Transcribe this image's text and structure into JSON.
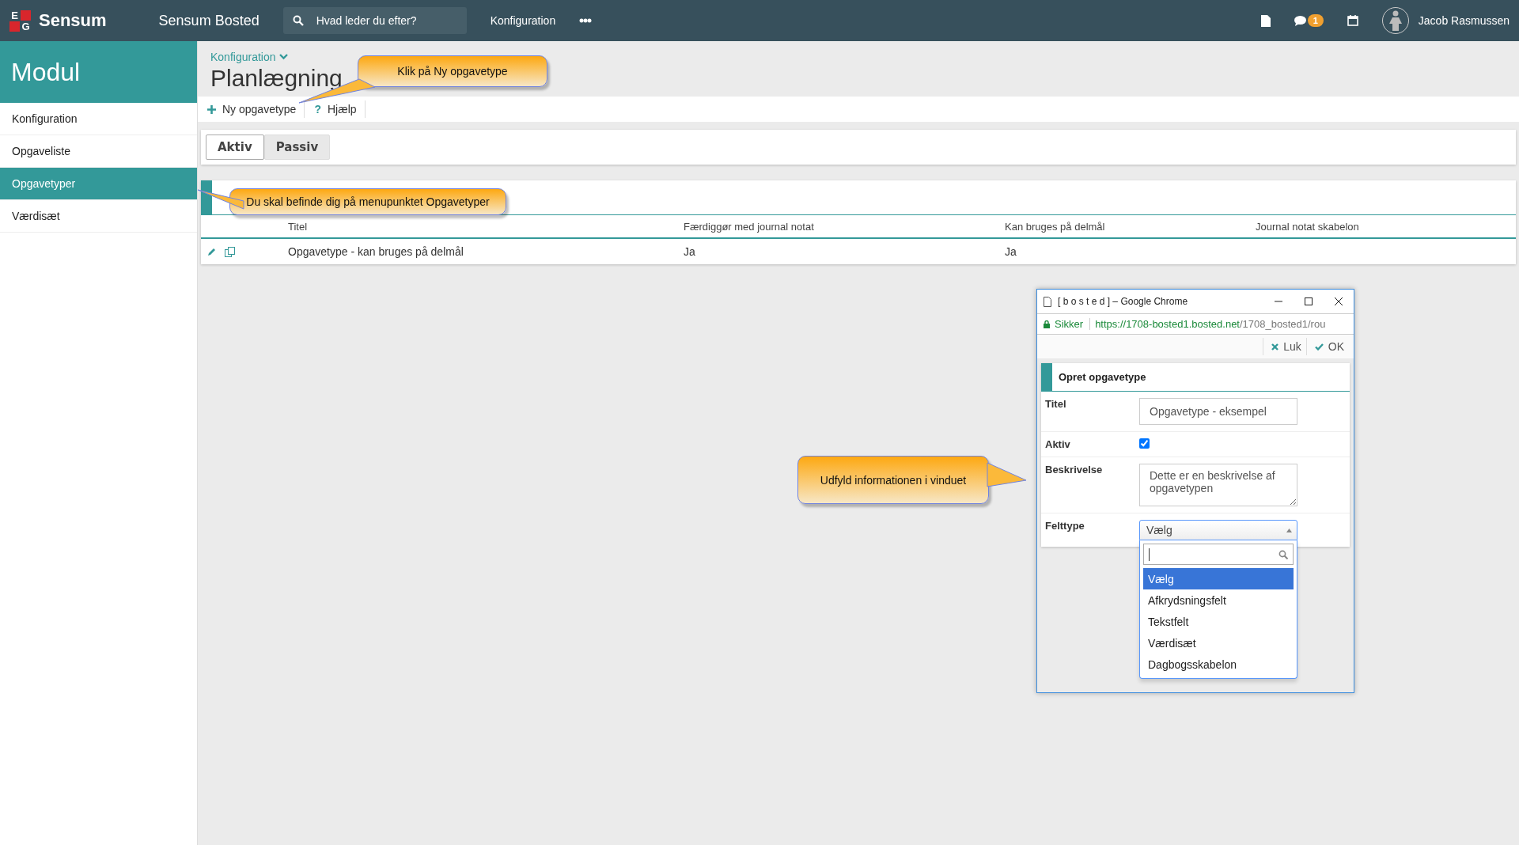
{
  "top_bar": {
    "logo_letters": [
      "E",
      "G"
    ],
    "logo_text": "Sensum",
    "app_title": "Sensum Bosted",
    "search": {
      "placeholder": "Hvad leder du efter?"
    },
    "nav": [
      "Konfiguration"
    ],
    "notification_count": "1",
    "user_name": "Jacob Rasmussen"
  },
  "sidebar": {
    "title": "Modul",
    "items": [
      {
        "label": "Konfiguration",
        "selected": false
      },
      {
        "label": "Opgaveliste",
        "selected": false
      },
      {
        "label": "Opgavetyper",
        "selected": true
      },
      {
        "label": "Værdisæt",
        "selected": false
      }
    ]
  },
  "breadcrumb": "Konfiguration",
  "page_title": "Planlægning",
  "toolbar": [
    {
      "kind": "add",
      "label": "Ny opgavetype"
    },
    {
      "kind": "help",
      "icon": "?",
      "label": "Hjælp"
    }
  ],
  "tabs": [
    {
      "label": "Aktiv",
      "selected": true
    },
    {
      "label": "Passiv",
      "selected": false
    }
  ],
  "table": {
    "columns": [
      "Titel",
      "Færdiggør med journal notat",
      "Kan bruges på delmål",
      "Journal notat skabelon"
    ],
    "rows": [
      {
        "cells": [
          "Opgavetype - kan bruges på delmål",
          "Ja",
          "Ja"
        ]
      }
    ]
  },
  "popup": {
    "title": "[ b o s t e d ] – Google Chrome",
    "secure_label": "Sikker",
    "url_host": "https://1708-bosted1.bosted.net",
    "url_path": "/1708_bosted1/rou",
    "actions": [
      {
        "kind": "close",
        "label": "Luk"
      },
      {
        "kind": "ok",
        "label": "OK"
      }
    ],
    "form_title": "Opret opgavetype",
    "fields": [
      {
        "kind": "text",
        "label": "Titel",
        "value": "Opgavetype - eksempel"
      },
      {
        "kind": "checkbox",
        "label": "Aktiv",
        "checked": true
      },
      {
        "kind": "textarea",
        "label": "Beskrivelse",
        "value": "Dette er en beskrivelse af opgavetypen"
      },
      {
        "kind": "select",
        "label": "Felttype",
        "value": "Vælg",
        "expanded": true,
        "options": [
          {
            "label": "Vælg",
            "selected": true
          },
          {
            "label": "Afkrydsningsfelt",
            "selected": false
          },
          {
            "label": "Tekstfelt",
            "selected": false
          },
          {
            "label": "Værdisæt",
            "selected": false
          },
          {
            "label": "Dagbogsskabelon",
            "selected": false
          }
        ]
      }
    ]
  },
  "callouts": [
    {
      "text": "Klik på Ny opgavetype"
    },
    {
      "text": "Du skal befinde dig på menupunktet Opgavetyper"
    },
    {
      "text": "Udfyld informationen i vinduet"
    }
  ]
}
